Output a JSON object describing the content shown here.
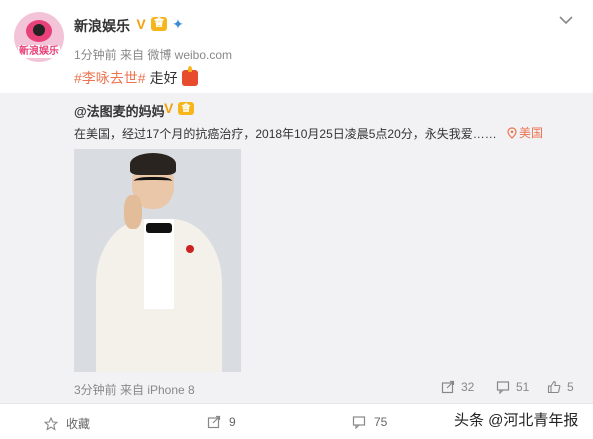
{
  "post": {
    "author": "新浪娱乐",
    "avatar_text": "新浪娱乐",
    "meta": "1分钟前 来自 微博 weibo.com",
    "hashtag": "#李咏去世#",
    "text": "走好"
  },
  "repost": {
    "author": "@法图麦的妈妈",
    "text": "在美国，经过17个月的抗癌治疗，2018年10月25日凌晨5点20分，永失我爱……",
    "location": "美国",
    "meta": "3分钟前 来自 iPhone 8",
    "forward_count": "32",
    "comment_count": "51",
    "like_count": "5"
  },
  "actions": {
    "favorite_label": "收藏",
    "forward_count": "9",
    "comment_count": "75"
  },
  "watermark": "头条 @河北青年报",
  "colors": {
    "accent": "#eb7350",
    "gold": "#f7b51c",
    "repost_bg": "#f2f2f5"
  }
}
